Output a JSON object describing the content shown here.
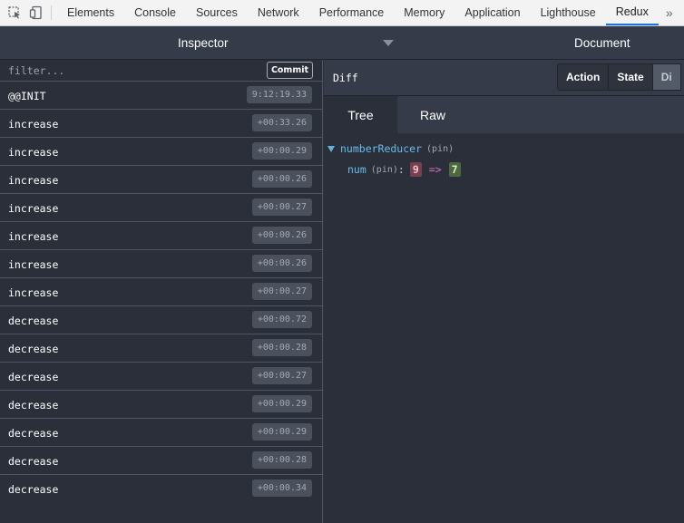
{
  "devtools": {
    "tabs": [
      "Elements",
      "Console",
      "Sources",
      "Network",
      "Performance",
      "Memory",
      "Application",
      "Lighthouse",
      "Redux"
    ],
    "active_tab": "Redux",
    "more_label": "»",
    "icons": [
      "inspect-element-icon",
      "device-toolbar-icon",
      "more-tabs-icon"
    ]
  },
  "redux_header": {
    "monitor_title": "Inspector",
    "document_title": "Document"
  },
  "action_list": {
    "filter_placeholder": "filter...",
    "filter_value": "",
    "commit_label": "Commit",
    "actions": [
      {
        "name": "@@INIT",
        "time": "9:12:19.33"
      },
      {
        "name": "increase",
        "time": "+00:33.26"
      },
      {
        "name": "increase",
        "time": "+00:00.29"
      },
      {
        "name": "increase",
        "time": "+00:00.26"
      },
      {
        "name": "increase",
        "time": "+00:00.27"
      },
      {
        "name": "increase",
        "time": "+00:00.26"
      },
      {
        "name": "increase",
        "time": "+00:00.26"
      },
      {
        "name": "increase",
        "time": "+00:00.27"
      },
      {
        "name": "decrease",
        "time": "+00:00.72"
      },
      {
        "name": "decrease",
        "time": "+00:00.28"
      },
      {
        "name": "decrease",
        "time": "+00:00.27"
      },
      {
        "name": "decrease",
        "time": "+00:00.29"
      },
      {
        "name": "decrease",
        "time": "+00:00.29"
      },
      {
        "name": "decrease",
        "time": "+00:00.28"
      },
      {
        "name": "decrease",
        "time": "+00:00.34"
      }
    ]
  },
  "diff_panel": {
    "title": "Diff",
    "modes": [
      "Action",
      "State",
      "Di"
    ],
    "active_mode": "Di",
    "view_tabs": [
      "Tree",
      "Raw"
    ],
    "active_view": "Tree",
    "tree": {
      "reducer_key": "numberReducer",
      "reducer_pin": "(pin)",
      "leaf_key": "num",
      "leaf_pin": "(pin)",
      "leaf_colon": ":",
      "old_value": "9",
      "arrow": "=>",
      "new_value": "7"
    }
  },
  "colors": {
    "background": "#2a2f3a",
    "header": "#353b48",
    "key_blue": "#67bde8",
    "old_value_bg": "#7a3f4e",
    "new_value_bg": "#4f6740",
    "arrow_pink": "#d672b5",
    "active_tab_underline": "#1a73e8"
  }
}
